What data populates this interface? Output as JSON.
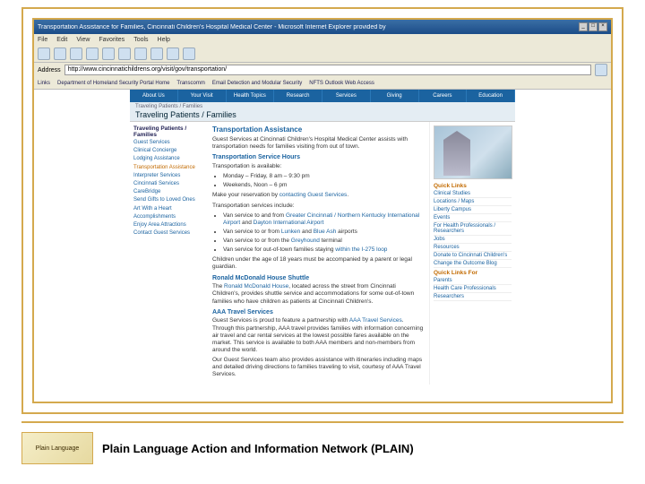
{
  "browser": {
    "window_title": "Transportation Assistance for Families, Cincinnati Children's Hospital Medical Center - Microsoft Internet Explorer provided by",
    "menu": [
      "File",
      "Edit",
      "View",
      "Favorites",
      "Tools",
      "Help"
    ],
    "address_label": "Address",
    "url": "http://www.cincinnatichildrens.org/visit/gov/transportation/",
    "links_label": "Links",
    "link_items": [
      "Department of Homeland Security Portal Home",
      "Transcomm",
      "Email Detection and Modular Security",
      "NFTS Outlook Web Access"
    ]
  },
  "nav": [
    "About Us",
    "Your Visit",
    "Health Topics",
    "Research",
    "Services",
    "Giving",
    "Careers",
    "Education"
  ],
  "page": {
    "breadcrumb": "Traveling Patients / Families",
    "title": "Traveling Patients / Families"
  },
  "sidebar": {
    "section": "Traveling Patients / Families",
    "items": [
      {
        "label": "Guest Services",
        "active": false
      },
      {
        "label": "Clinical Concierge",
        "active": false
      },
      {
        "label": "Lodging Assistance",
        "active": false
      },
      {
        "label": "Transportation Assistance",
        "active": true
      },
      {
        "label": "Interpreter Services",
        "active": false
      },
      {
        "label": "Cincinnati Services",
        "active": false
      },
      {
        "label": "CareBridge",
        "active": false
      },
      {
        "label": "Send Gifts to Loved Ones",
        "active": false
      },
      {
        "label": "Art With a Heart",
        "active": false
      },
      {
        "label": "Accomplishments",
        "active": false
      },
      {
        "label": "Enjoy Area Attractions",
        "active": false
      },
      {
        "label": "Contact Guest Services",
        "active": false
      }
    ]
  },
  "main": {
    "heading": "Transportation Assistance",
    "intro": "Guest Services at Cincinnati Children's Hospital Medical Center assists with transportation needs for families visiting from out of town.",
    "hours_heading": "Transportation Service Hours",
    "hours_label": "Transportation is available:",
    "hours": [
      "Monday – Friday, 8 am – 9:30 pm",
      "Weekends, Noon – 6 pm"
    ],
    "reserve_prefix": "Make your reservation by ",
    "reserve_link": "contacting Guest Services",
    "reserve_suffix": ".",
    "services_label": "Transportation services include:",
    "services": [
      {
        "pre": "Van service to and from ",
        "link1": "Greater Cincinnati / Northern Kentucky International Airport",
        "mid": " and ",
        "link2": "Dayton International Airport"
      },
      {
        "pre": "Van service to or from ",
        "link1": "Lunken",
        "mid": " and ",
        "link2": "Blue Ash",
        "post": " airports"
      },
      {
        "pre": "Van service to or from the ",
        "link1": "Greyhound",
        "post": " terminal"
      },
      {
        "pre": "Van service for out-of-town families staying ",
        "link1": "within the I-275 loop"
      }
    ],
    "minors_note": "Children under the age of 18 years must be accompanied by a parent or legal guardian.",
    "rmh_heading": "Ronald McDonald House Shuttle",
    "rmh_prefix": "The ",
    "rmh_link": "Ronald McDonald House",
    "rmh_text": ", located across the street from Cincinnati Children's, provides shuttle service and accommodations for some out-of-town families who have children as patients at Cincinnati Children's.",
    "aaa_heading": "AAA Travel Services",
    "aaa_prefix": "Guest Services is proud to feature a partnership with ",
    "aaa_link": "AAA Travel Services",
    "aaa_text": ". Through this partnership, AAA travel provides families with information concerning air travel and car rental services at the lowest possible fares available on the market. This service is available to both AAA members and non-members from around the world.",
    "aaa_text2": "Our Guest Services team also provides assistance with itineraries including maps and detailed driving directions to families traveling to visit, courtesy of AAA Travel Services."
  },
  "rightcol": {
    "quick_links_heading": "Quick Links",
    "quick_links": [
      "Clinical Studies",
      "Locations / Maps",
      "Liberty Campus",
      "Events",
      "For Health Professionals / Researchers",
      "Jobs",
      "Resources",
      "Donate to Cincinnati Children's",
      "Change the Outcome Blog"
    ],
    "quick_links_for_heading": "Quick Links For",
    "quick_links_for": [
      "Parents",
      "Health Care Professionals",
      "Researchers"
    ]
  },
  "footer": {
    "logo_text": "Plain Language",
    "text": "Plain Language Action and Information Network (PLAIN)"
  }
}
